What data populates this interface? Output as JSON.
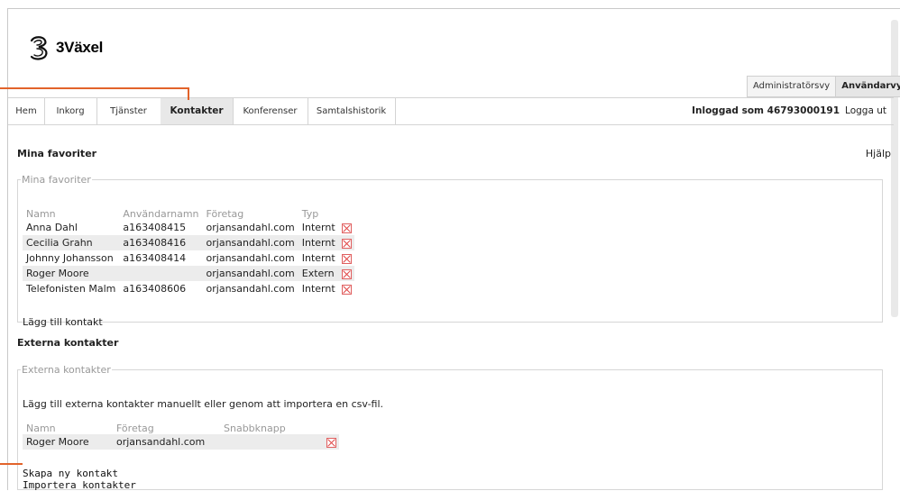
{
  "logo": {
    "text": "3Växel",
    "icon": "three-logo-icon"
  },
  "view_tabs": [
    {
      "label": "Administratörsvy",
      "active": false
    },
    {
      "label": "Användarvy",
      "active": true
    }
  ],
  "nav": {
    "items": [
      {
        "label": "Hem",
        "active": false
      },
      {
        "label": "Inkorg",
        "active": false
      },
      {
        "label": "Tjänster",
        "active": false
      },
      {
        "label": "Kontakter",
        "active": true
      },
      {
        "label": "Konferenser",
        "active": false
      },
      {
        "label": "Samtalshistorik",
        "active": false
      }
    ],
    "logged_in_label": "Inloggad som 46793000191",
    "logout_label": "Logga ut"
  },
  "favorites": {
    "title": "Mina favoriter",
    "help_label": "Hjälp",
    "legend": "Mina favoriter",
    "columns": [
      "Namn",
      "Användarnamn",
      "Företag",
      "Typ"
    ],
    "rows": [
      {
        "name": "Anna Dahl",
        "username": "a163408415",
        "company": "orjansandahl.com",
        "type": "Internt"
      },
      {
        "name": "Cecilia Grahn",
        "username": "a163408416",
        "company": "orjansandahl.com",
        "type": "Internt"
      },
      {
        "name": "Johnny Johansson",
        "username": "a163408414",
        "company": "orjansandahl.com",
        "type": "Internt"
      },
      {
        "name": "Roger Moore",
        "username": "",
        "company": "orjansandahl.com",
        "type": "Extern"
      },
      {
        "name": "Telefonisten Malm",
        "username": "a163408606",
        "company": "orjansandahl.com",
        "type": "Internt"
      }
    ],
    "add_label": "Lägg till kontakt"
  },
  "external": {
    "title": "Externa kontakter",
    "legend": "Externa kontakter",
    "description": "Lägg till externa kontakter manuellt eller genom att importera en csv-fil.",
    "columns": [
      "Namn",
      "Företag",
      "Snabbknapp"
    ],
    "rows": [
      {
        "name": "Roger Moore",
        "company": "orjansandahl.com",
        "speed_dial": ""
      }
    ],
    "create_label": "Skapa ny kontakt",
    "import_label": "Importera kontakter"
  },
  "colors": {
    "accent": "#e2632a",
    "delete": "#e04848",
    "active_tab": "#e8e8e8"
  }
}
